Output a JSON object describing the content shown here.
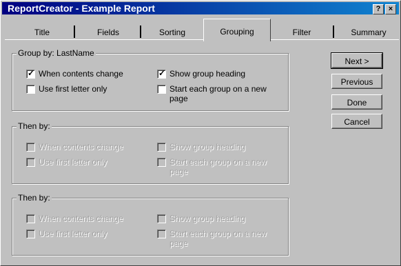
{
  "window": {
    "title": "ReportCreator - Example Report",
    "help_label": "?",
    "close_label": "×"
  },
  "tabs": [
    "Title",
    "Fields",
    "Sorting",
    "Grouping",
    "Filter",
    "Summary"
  ],
  "groups": [
    {
      "title": "Group by: LastName",
      "options": {
        "when_contents_change": "When contents change",
        "use_first_letter": "Use first letter only",
        "show_heading": "Show group heading",
        "start_new_page_1": "Start each group on a new",
        "start_new_page_2": "page"
      },
      "checked": {
        "when_contents_change": true,
        "use_first_letter": false,
        "show_heading": true,
        "start_new_page": false
      }
    },
    {
      "title": "Then by:",
      "options": {
        "when_contents_change": "When contents change",
        "use_first_letter": "Use first letter only",
        "show_heading": "Show group heading",
        "start_new_page_1": "Start each group on a new",
        "start_new_page_2": "page"
      }
    },
    {
      "title": "Then by:",
      "options": {
        "when_contents_change": "When contents change",
        "use_first_letter": "Use first letter only",
        "show_heading": "Show group heading",
        "start_new_page_1": "Start each group on a new",
        "start_new_page_2": "page"
      }
    }
  ],
  "buttons": {
    "next": "Next >",
    "previous": "Previous",
    "done": "Done",
    "cancel": "Cancel"
  }
}
